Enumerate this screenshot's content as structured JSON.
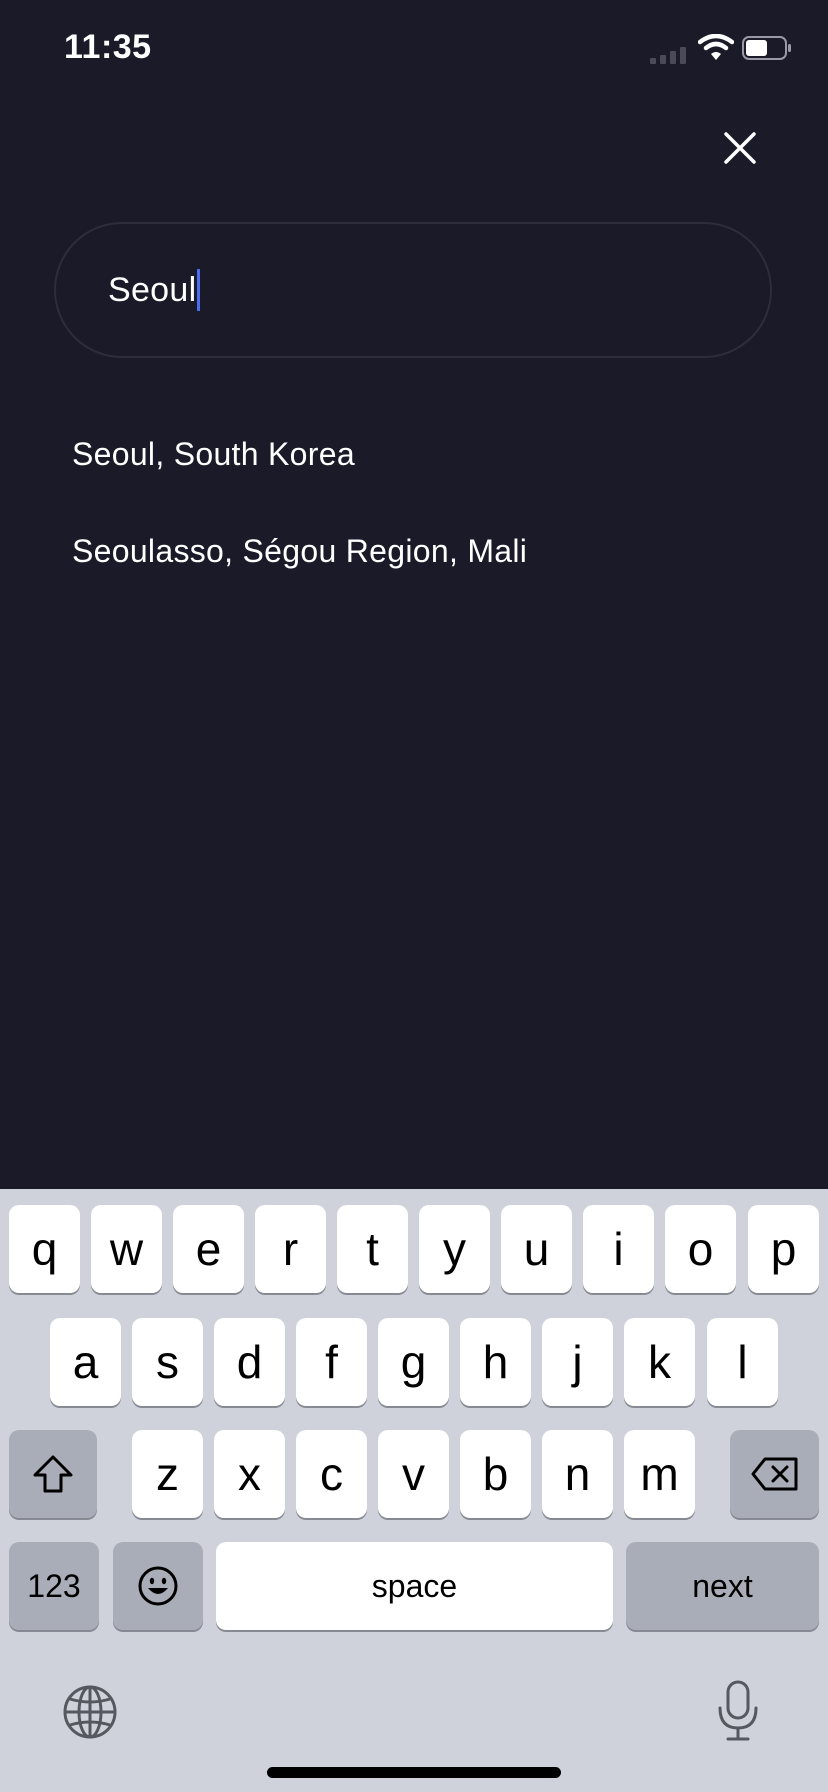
{
  "status_bar": {
    "time": "11:35",
    "icons": [
      "cellular-signal-icon",
      "wifi-icon",
      "battery-icon"
    ]
  },
  "close_icon": "close-icon",
  "search": {
    "value": "Seoul"
  },
  "results": [
    {
      "label": "Seoul, South Korea"
    },
    {
      "label": "Seoulasso, Ségou Region, Mali"
    }
  ],
  "keyboard": {
    "row1": [
      "q",
      "w",
      "e",
      "r",
      "t",
      "y",
      "u",
      "i",
      "o",
      "p"
    ],
    "row2": [
      "a",
      "s",
      "d",
      "f",
      "g",
      "h",
      "j",
      "k",
      "l"
    ],
    "row3": [
      "z",
      "x",
      "c",
      "v",
      "b",
      "n",
      "m"
    ],
    "numbers_label": "123",
    "space_label": "space",
    "return_label": "next",
    "icons": [
      "shift-icon",
      "delete-icon",
      "emoji-icon",
      "globe-icon",
      "microphone-icon"
    ]
  },
  "colors": {
    "background": "#1b1a28",
    "caret": "#4b6ef0",
    "keyboard_bg": "#cfd2db"
  }
}
